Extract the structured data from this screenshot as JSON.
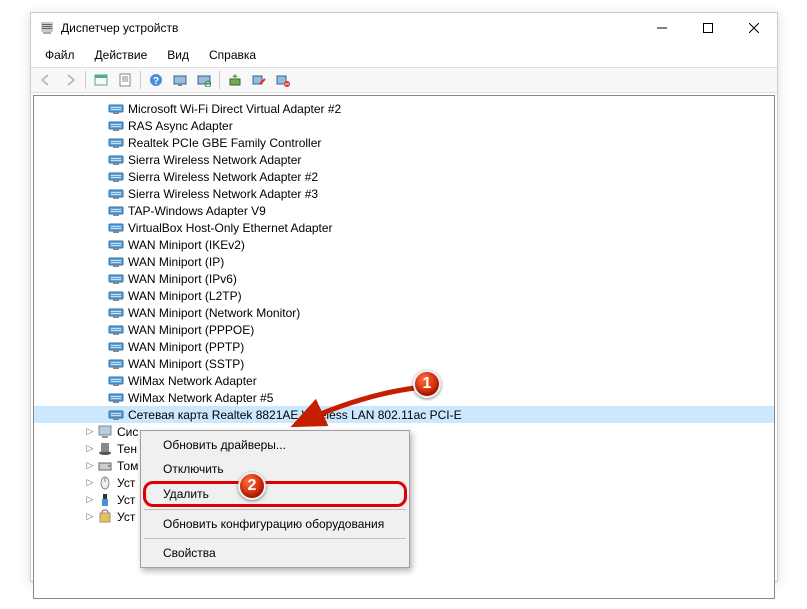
{
  "window": {
    "title": "Диспетчер устройств"
  },
  "menu": {
    "items": [
      "Файл",
      "Действие",
      "Вид",
      "Справка"
    ]
  },
  "toolbar": {
    "back": "back-icon",
    "forward": "forward-icon",
    "properties": "properties-icon",
    "tree": "tree-icon",
    "help": "help-icon",
    "monitor": "monitor-icon",
    "refresh": "refresh-icon",
    "plug": "plug-icon",
    "enable": "enable-icon",
    "disable": "disable-icon",
    "uninstall": "uninstall-icon"
  },
  "devices": [
    {
      "label": "Microsoft Wi-Fi Direct Virtual Adapter #2",
      "icon": "net"
    },
    {
      "label": "RAS Async Adapter",
      "icon": "net"
    },
    {
      "label": "Realtek PCIe GBE Family Controller",
      "icon": "net"
    },
    {
      "label": "Sierra Wireless Network Adapter",
      "icon": "net"
    },
    {
      "label": "Sierra Wireless Network Adapter #2",
      "icon": "net"
    },
    {
      "label": "Sierra Wireless Network Adapter #3",
      "icon": "net"
    },
    {
      "label": "TAP-Windows Adapter V9",
      "icon": "net"
    },
    {
      "label": "VirtualBox Host-Only Ethernet Adapter",
      "icon": "net"
    },
    {
      "label": "WAN Miniport (IKEv2)",
      "icon": "net"
    },
    {
      "label": "WAN Miniport (IP)",
      "icon": "net"
    },
    {
      "label": "WAN Miniport (IPv6)",
      "icon": "net"
    },
    {
      "label": "WAN Miniport (L2TP)",
      "icon": "net"
    },
    {
      "label": "WAN Miniport (Network Monitor)",
      "icon": "net"
    },
    {
      "label": "WAN Miniport (PPPOE)",
      "icon": "net"
    },
    {
      "label": "WAN Miniport (PPTP)",
      "icon": "net"
    },
    {
      "label": "WAN Miniport (SSTP)",
      "icon": "net"
    },
    {
      "label": "WiMax Network Adapter",
      "icon": "net"
    },
    {
      "label": "WiMax Network Adapter #5",
      "icon": "net"
    },
    {
      "label": "Сетевая карта Realtek 8821AE Wireless LAN 802.11ac PCI-E",
      "icon": "net",
      "selected": true
    }
  ],
  "categories": [
    {
      "label": "Сис",
      "icon": "pc"
    },
    {
      "label": "Тен",
      "icon": "shadow"
    },
    {
      "label": "Том",
      "icon": "disk"
    },
    {
      "label": "Уст",
      "icon": "hid"
    },
    {
      "label": "Уст",
      "icon": "usb"
    },
    {
      "label": "Уст",
      "icon": "sec"
    }
  ],
  "context": {
    "update": "Обновить драйверы...",
    "disable": "Отключить",
    "delete": "Удалить",
    "rescan": "Обновить конфигурацию оборудования",
    "props": "Свойства"
  },
  "annotations": {
    "b1": "1",
    "b2": "2"
  }
}
